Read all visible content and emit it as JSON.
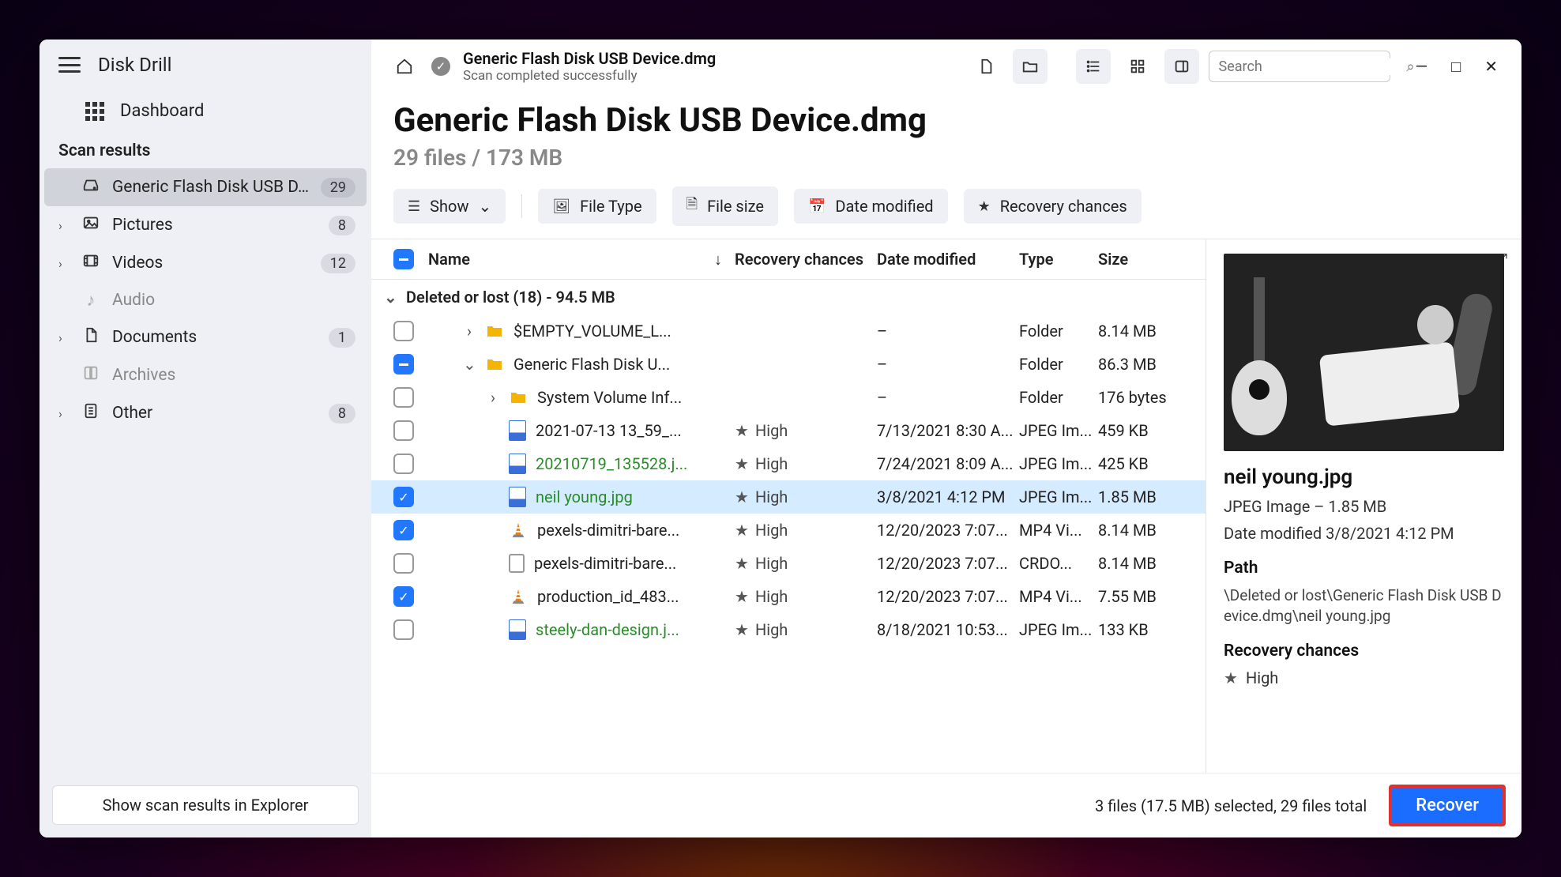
{
  "app": {
    "title": "Disk Drill",
    "dashboard": "Dashboard",
    "section": "Scan results",
    "explorer_btn": "Show scan results in Explorer"
  },
  "sidebar": {
    "items": [
      {
        "label": "Generic Flash Disk USB D...",
        "badge": "29",
        "icon": "drive"
      },
      {
        "label": "Pictures",
        "badge": "8",
        "icon": "image"
      },
      {
        "label": "Videos",
        "badge": "12",
        "icon": "video"
      },
      {
        "label": "Audio",
        "badge": "",
        "icon": "audio"
      },
      {
        "label": "Documents",
        "badge": "1",
        "icon": "doc"
      },
      {
        "label": "Archives",
        "badge": "",
        "icon": "archive"
      },
      {
        "label": "Other",
        "badge": "8",
        "icon": "other"
      }
    ]
  },
  "topbar": {
    "title": "Generic Flash Disk USB Device.dmg",
    "subtitle": "Scan completed successfully",
    "search_placeholder": "Search"
  },
  "header": {
    "title": "Generic Flash Disk USB Device.dmg",
    "subtitle": "29 files / 173 MB"
  },
  "filters": {
    "show": "Show",
    "filetype": "File Type",
    "filesize": "File size",
    "date": "Date modified",
    "recovery": "Recovery chances"
  },
  "columns": {
    "name": "Name",
    "recovery": "Recovery chances",
    "date": "Date modified",
    "type": "Type",
    "size": "Size"
  },
  "group": "Deleted or lost (18) - 94.5 MB",
  "files": [
    {
      "cb": "",
      "indent": 1,
      "caret": "right",
      "icon": "folder",
      "name": "$EMPTY_VOLUME_L...",
      "green": false,
      "rec": "",
      "date": "–",
      "type": "Folder",
      "size": "8.14 MB"
    },
    {
      "cb": "partial",
      "indent": 1,
      "caret": "down",
      "icon": "folder",
      "name": "Generic Flash Disk U...",
      "green": false,
      "rec": "",
      "date": "–",
      "type": "Folder",
      "size": "86.3 MB"
    },
    {
      "cb": "",
      "indent": 2,
      "caret": "right",
      "icon": "folder",
      "name": "System Volume Inf...",
      "green": false,
      "rec": "",
      "date": "–",
      "type": "Folder",
      "size": "176 bytes"
    },
    {
      "cb": "",
      "indent": 2,
      "caret": "",
      "icon": "img",
      "name": "2021-07-13 13_59_...",
      "green": false,
      "rec": "High",
      "date": "7/13/2021 8:30 A...",
      "type": "JPEG Im...",
      "size": "459 KB"
    },
    {
      "cb": "",
      "indent": 2,
      "caret": "",
      "icon": "img",
      "name": "20210719_135528.j...",
      "green": true,
      "rec": "High",
      "date": "7/24/2021 8:09 A...",
      "type": "JPEG Im...",
      "size": "425 KB"
    },
    {
      "cb": "checked",
      "indent": 2,
      "caret": "",
      "icon": "img",
      "name": "neil young.jpg",
      "green": true,
      "rec": "High",
      "date": "3/8/2021 4:12 PM",
      "type": "JPEG Im...",
      "size": "1.85 MB",
      "selected": true
    },
    {
      "cb": "checked",
      "indent": 2,
      "caret": "",
      "icon": "vlc",
      "name": "pexels-dimitri-bare...",
      "green": false,
      "rec": "High",
      "date": "12/20/2023 7:07...",
      "type": "MP4 Vi...",
      "size": "8.14 MB"
    },
    {
      "cb": "",
      "indent": 2,
      "caret": "",
      "icon": "doc",
      "name": "pexels-dimitri-bare...",
      "green": false,
      "rec": "High",
      "date": "12/20/2023 7:07...",
      "type": "CRDO...",
      "size": "8.14 MB"
    },
    {
      "cb": "checked",
      "indent": 2,
      "caret": "",
      "icon": "vlc",
      "name": "production_id_483...",
      "green": false,
      "rec": "High",
      "date": "12/20/2023 7:07...",
      "type": "MP4 Vi...",
      "size": "7.55 MB"
    },
    {
      "cb": "",
      "indent": 2,
      "caret": "",
      "icon": "img",
      "name": "steely-dan-design.j...",
      "green": true,
      "rec": "High",
      "date": "8/18/2021 10:53...",
      "type": "JPEG Im...",
      "size": "133 KB"
    }
  ],
  "preview": {
    "name": "neil young.jpg",
    "meta": "JPEG Image – 1.85 MB",
    "modified": "Date modified 3/8/2021 4:12 PM",
    "path_h": "Path",
    "path": "\\Deleted or lost\\Generic Flash Disk USB Device.dmg\\neil young.jpg",
    "rec_h": "Recovery chances",
    "rec": "High"
  },
  "footer": {
    "status": "3 files (17.5 MB) selected, 29 files total",
    "recover": "Recover"
  }
}
